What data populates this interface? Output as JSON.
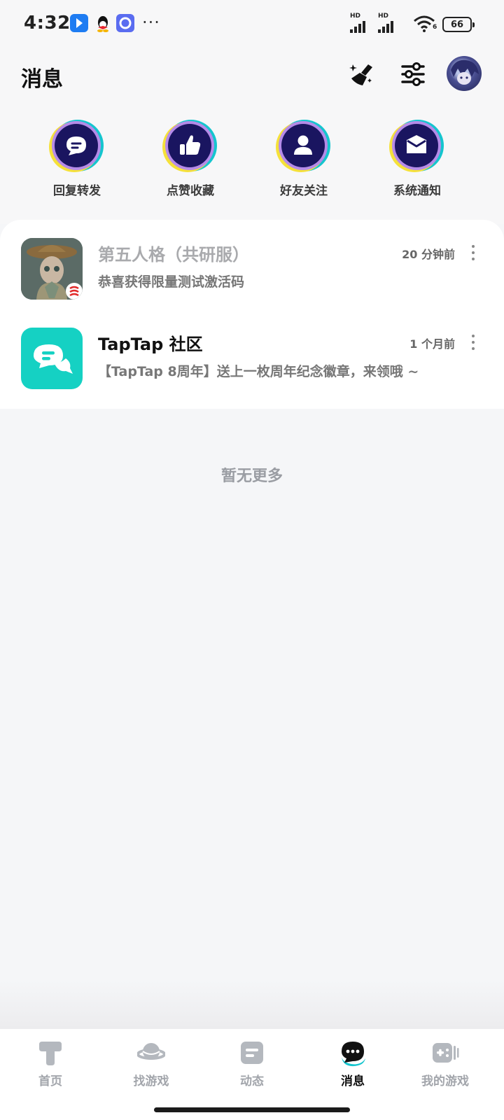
{
  "status_bar": {
    "time": "4:32",
    "hd1": "HD",
    "hd2": "HD",
    "wifi_badge": "6",
    "battery": "66"
  },
  "header": {
    "title": "消息"
  },
  "categories": [
    {
      "label": "回复转发",
      "icon": "comment-icon"
    },
    {
      "label": "点赞收藏",
      "icon": "thumbs-up-icon"
    },
    {
      "label": "好友关注",
      "icon": "user-icon"
    },
    {
      "label": "系统通知",
      "icon": "envelope-icon"
    }
  ],
  "messages": [
    {
      "title": "第五人格（共研服）",
      "time": "20 分钟前",
      "preview": "恭喜获得限量测试激活码"
    },
    {
      "title": "TapTap 社区",
      "time": "1 个月前",
      "preview": "【TapTap 8周年】送上一枚周年纪念徽章，来领哦 ~"
    }
  ],
  "empty_text": "暂无更多",
  "nav": [
    {
      "label": "首页"
    },
    {
      "label": "找游戏"
    },
    {
      "label": "动态"
    },
    {
      "label": "消息"
    },
    {
      "label": "我的游戏"
    }
  ],
  "colors": {
    "accent": "#15c5ce",
    "nav_active": "#111111",
    "nav_inactive": "#a2a5ab",
    "ring_dark": "#1a1560",
    "ring_yellow": "#f5e13a",
    "ring_purple": "#b58be8"
  }
}
